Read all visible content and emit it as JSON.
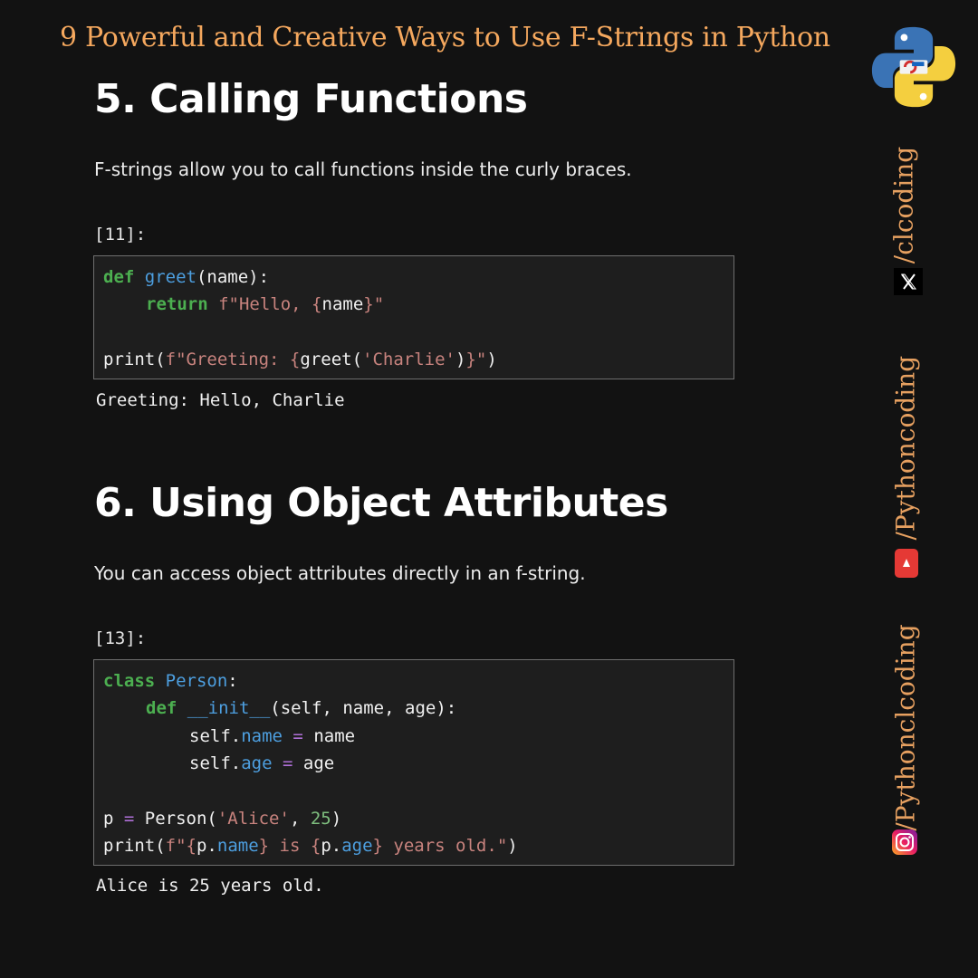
{
  "header": {
    "title": "9 Powerful and Creative Ways to Use F-Strings in Python",
    "logo_icon": "python-logo-icon"
  },
  "sections": [
    {
      "heading": "5. Calling Functions",
      "description": "F-strings allow you to call functions inside the curly braces.",
      "cell_label": "[11]:",
      "code_lines": [
        "def greet(name):",
        "    return f\"Hello, {name}\"",
        "",
        "print(f\"Greeting: {greet('Charlie')}\")"
      ],
      "output": "Greeting: Hello, Charlie"
    },
    {
      "heading": "6. Using Object Attributes",
      "description": "You can access object attributes directly in an f-string.",
      "cell_label": "[13]:",
      "code_lines": [
        "class Person:",
        "    def __init__(self, name, age):",
        "        self.name = name",
        "        self.age = age",
        "",
        "p = Person('Alice', 25)",
        "print(f\"{p.name} is {p.age} years old.\")"
      ],
      "output": "Alice is 25 years old."
    }
  ],
  "sidebar": {
    "handles": [
      {
        "text": "/clcoding",
        "icon": "x-twitter-icon"
      },
      {
        "text": "/Pythoncoding",
        "icon": "youtube-icon"
      },
      {
        "text": "/Pythonclcoding",
        "icon": "instagram-icon"
      }
    ]
  },
  "colors": {
    "background": "#121212",
    "title_accent": "#f5a85e",
    "keyword": "#4caf50",
    "function_name": "#4d9fe0",
    "string": "#c8837e",
    "operator": "#b070d8",
    "code_background": "#1e1e1e"
  }
}
